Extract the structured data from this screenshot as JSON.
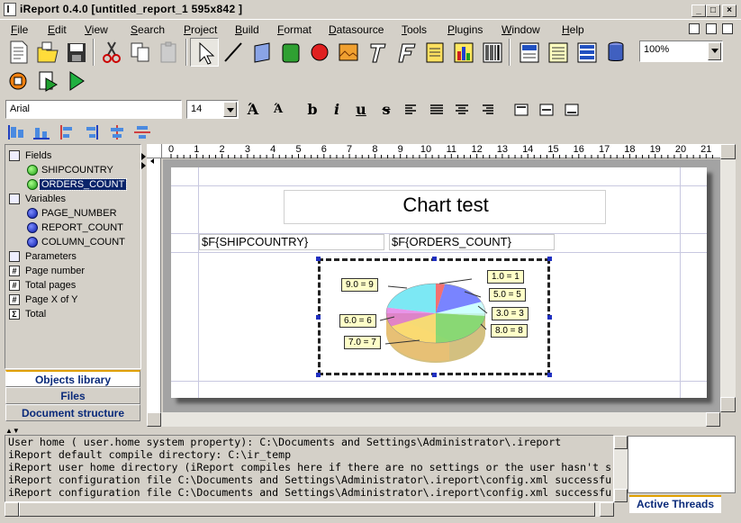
{
  "window": {
    "title": "iReport 0.4.0  [untitled_report_1 595x842  ]",
    "minimize": "_",
    "maximize": "□",
    "close": "×"
  },
  "menubar": [
    {
      "label": "File",
      "u": "F",
      "rest": "ile"
    },
    {
      "label": "Edit",
      "u": "E",
      "rest": "dit"
    },
    {
      "label": "View",
      "u": "V",
      "rest": "iew"
    },
    {
      "label": "Search",
      "u": "S",
      "rest": "earch"
    },
    {
      "label": "Project",
      "u": "P",
      "rest": "roject"
    },
    {
      "label": "Build",
      "u": "B",
      "rest": "uild"
    },
    {
      "label": "Format",
      "u": "F",
      "rest": "ormat"
    },
    {
      "label": "Datasource",
      "u": "D",
      "rest": "atasource"
    },
    {
      "label": "Tools",
      "u": "T",
      "rest": "ools"
    },
    {
      "label": "Plugins",
      "u": "P",
      "rest": "lugins"
    },
    {
      "label": "Window",
      "u": "W",
      "rest": "indow"
    },
    {
      "label": "Help",
      "u": "H",
      "rest": "elp"
    }
  ],
  "toolbar": {
    "zoom_value": "100%",
    "font_name": "Arial",
    "font_size": "14",
    "bold": "b",
    "italic": "i",
    "underline": "u",
    "strike": "s"
  },
  "library_tree": {
    "fields_label": "Fields",
    "fields": [
      "SHIPCOUNTRY",
      "ORDERS_COUNT"
    ],
    "selected_field": "ORDERS_COUNT",
    "variables_label": "Variables",
    "variables": [
      "PAGE_NUMBER",
      "REPORT_COUNT",
      "COLUMN_COUNT"
    ],
    "parameters_label": "Parameters",
    "builtins": [
      {
        "label": "Page number",
        "icon": "#"
      },
      {
        "label": "Total pages",
        "icon": "#"
      },
      {
        "label": "Page X of Y",
        "icon": "#"
      },
      {
        "label": "Total",
        "icon": "Σ"
      }
    ]
  },
  "side_tabs": [
    "Objects library",
    "Files",
    "Document structure"
  ],
  "ruler_numbers": [
    "0",
    "1",
    "2",
    "3",
    "4",
    "5",
    "6",
    "7",
    "8",
    "9",
    "10",
    "11",
    "12",
    "13",
    "14",
    "15",
    "16",
    "17",
    "18",
    "19",
    "20",
    "21"
  ],
  "report": {
    "title_text": "Chart test",
    "field_shipcountry": "$F{SHIPCOUNTRY}",
    "field_orders_count": "$F{ORDERS_COUNT}",
    "chart_labels": [
      "1.0 = 1",
      "5.0 = 5",
      "3.0 = 3",
      "8.0 = 8",
      "9.0 = 9",
      "6.0 = 6",
      "7.0 = 7"
    ]
  },
  "console_lines": [
    "User home ( user.home system property): C:\\Documents and Settings\\Administrator\\.ireport",
    "iReport default compile directory: C:\\ir_temp",
    "iReport user home directory (iReport compiles here if there are no settings or the user hasn't s",
    "iReport configuration file C:\\Documents and Settings\\Administrator\\.ireport\\config.xml successfu",
    "iReport configuration file C:\\Documents and Settings\\Administrator\\.ireport\\config.xml successfu"
  ],
  "threads_tab": "Active Threads",
  "colors": {
    "selection": "#0a246a",
    "tab_accent": "#e0a000",
    "tab_text": "#0a2a7a"
  }
}
